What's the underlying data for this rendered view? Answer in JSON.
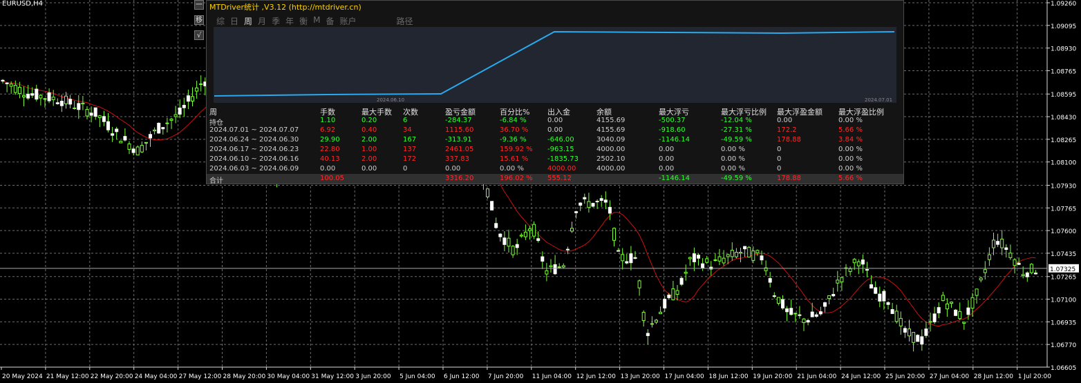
{
  "symbol": "EURUSD,H4",
  "side_buttons": [
    "一",
    "移",
    "√"
  ],
  "panel": {
    "title": "MTDriver统计 ,V3.12 (http://mtdriver.cn)",
    "tabs": [
      "综",
      "日",
      "周",
      "月",
      "季",
      "年",
      "衡",
      "M",
      "备",
      "账户",
      "路径"
    ],
    "active_tab": "周",
    "equity_curve": {
      "x_labels": [
        "2024.06.10",
        "2024.07.01"
      ],
      "values": [
        4000.0,
        4000.0,
        4000.0,
        4155.69,
        4155.69,
        4155.69,
        4155.69
      ]
    },
    "columns": [
      "周",
      "手数",
      "最大手数",
      "次数",
      "盈亏金额",
      "百分比%",
      "出入金",
      "余额",
      "最大浮亏",
      "最大浮亏比例",
      "最大浮盈金额",
      "最大浮盈比例"
    ],
    "rows": [
      {
        "cells": [
          "持仓",
          "1.10",
          "0.20",
          "6",
          "-284.37",
          "-6.84 %",
          "0.00",
          "4155.69",
          "-500.37",
          "-12.04 %",
          "0.00",
          "0.00 %"
        ],
        "colors": [
          "w",
          "g",
          "g",
          "g",
          "g",
          "g",
          "w",
          "w",
          "g",
          "g",
          "w",
          "w"
        ]
      },
      {
        "cells": [
          "2024.07.01 ~ 2024.07.07",
          "6.92",
          "0.40",
          "34",
          "1115.60",
          "36.70 %",
          "0.00",
          "4155.69",
          "-918.60",
          "-27.31 %",
          "172.2",
          "5.66 %"
        ],
        "colors": [
          "w",
          "r",
          "r",
          "r",
          "r",
          "r",
          "w",
          "w",
          "g",
          "g",
          "r",
          "r"
        ]
      },
      {
        "cells": [
          "2024.06.24 ~ 2024.06.30",
          "29.90",
          "2.00",
          "167",
          "-313.91",
          "-9.36 %",
          "-646.00",
          "3040.09",
          "-1146.14",
          "-49.59 %",
          "178.88",
          "3.84 %"
        ],
        "colors": [
          "w",
          "g",
          "g",
          "g",
          "g",
          "g",
          "g",
          "w",
          "g",
          "g",
          "r",
          "r"
        ]
      },
      {
        "cells": [
          "2024.06.17 ~ 2024.06.23",
          "22.80",
          "1.00",
          "137",
          "2461.05",
          "159.92 %",
          "-963.15",
          "4000.00",
          "0.00",
          "0.00 %",
          "0",
          "0.00 %"
        ],
        "colors": [
          "w",
          "r",
          "r",
          "r",
          "r",
          "r",
          "g",
          "w",
          "w",
          "w",
          "w",
          "w"
        ]
      },
      {
        "cells": [
          "2024.06.10 ~ 2024.06.16",
          "40.13",
          "2.00",
          "172",
          "337.83",
          "15.61 %",
          "-1835.73",
          "2502.10",
          "0.00",
          "0.00 %",
          "0",
          "0.00 %"
        ],
        "colors": [
          "w",
          "r",
          "r",
          "r",
          "r",
          "r",
          "g",
          "w",
          "w",
          "w",
          "w",
          "w"
        ]
      },
      {
        "cells": [
          "2024.06.03 ~ 2024.06.09",
          "0.00",
          "0.00",
          "0",
          "0.00",
          "0.00 %",
          "4000.00",
          "4000.00",
          "0.00",
          "0.00 %",
          "0",
          "0.00 %"
        ],
        "colors": [
          "w",
          "w",
          "w",
          "w",
          "w",
          "w",
          "r",
          "w",
          "w",
          "w",
          "w",
          "w"
        ]
      }
    ],
    "total": {
      "cells": [
        "合计",
        "100.05",
        "",
        "",
        "3316.20",
        "196.02 %",
        "555.12",
        "",
        "-1146.14",
        "-49.59 %",
        "178.88",
        "5.66 %"
      ],
      "colors": [
        "w",
        "r",
        "w",
        "w",
        "r",
        "r",
        "r",
        "w",
        "g",
        "g",
        "r",
        "r"
      ]
    }
  },
  "price_axis": {
    "labels": [
      "1.09260",
      "1.09095",
      "1.08930",
      "1.08765",
      "1.08595",
      "1.08430",
      "1.08265",
      "1.08100",
      "1.07930",
      "1.07765",
      "1.07600",
      "1.07435",
      "1.07265",
      "1.07100",
      "1.06935",
      "1.06770",
      "1.06605"
    ],
    "current_price": "1.07325"
  },
  "time_axis": [
    "20 May 2024",
    "21 May 12:00",
    "22 May 20:00",
    "24 May 04:00",
    "27 May 12:00",
    "28 May 20:00",
    "30 May 04:00",
    "31 May 12:00",
    "3 Jun 20:00",
    "5 Jun 04:00",
    "6 Jun 12:00",
    "7 Jun 20:00",
    "11 Jun 04:00",
    "12 Jun 12:00",
    "13 Jun 20:00",
    "17 Jun 04:00",
    "18 Jun 12:00",
    "19 Jun 20:00",
    "21 Jun 04:00",
    "24 Jun 12:00",
    "25 Jun 20:00",
    "27 Jun 04:00",
    "28 Jun 12:00",
    "1 Jul 20:00"
  ],
  "colors": {
    "background": "#000000",
    "grid": "#6e6e6e",
    "bull": "#7dff3a",
    "ma": "#cc1010",
    "equity": "#29aaee",
    "title": "#ffd200"
  }
}
